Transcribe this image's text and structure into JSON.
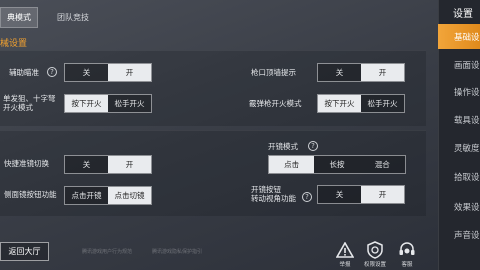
{
  "tabs": [
    {
      "label": "典模式",
      "active": true
    },
    {
      "label": "团队竞技",
      "active": false
    }
  ],
  "section_title": "械设置",
  "settings": {
    "aim_assist": {
      "label": "辅助瞄准",
      "options": [
        "关",
        "开"
      ],
      "selected": "开"
    },
    "scope_hint": {
      "label": "枪口顶墙提示",
      "options": [
        "关",
        "开"
      ],
      "selected": "开"
    },
    "single_fire": {
      "label_line1": "单发狙、十字弩",
      "label_line2": "开火模式",
      "options": [
        "按下开火",
        "松手开火"
      ],
      "selected": "按下开火"
    },
    "burst_fire": {
      "label": "霰弹枪开火模式",
      "options": [
        "按下开火",
        "松手开火"
      ],
      "selected": "按下开火"
    },
    "quick_scope": {
      "label": "快捷准镜切换",
      "options": [
        "关",
        "开"
      ],
      "selected": "开"
    },
    "scope_mode": {
      "label": "开镜模式",
      "options": [
        "点击",
        "长按",
        "混合"
      ],
      "selected": "点击"
    },
    "side_scope": {
      "label": "侧面镜按钮功能",
      "options": [
        "点击开镜",
        "点击切镜"
      ],
      "selected": "点击切镜"
    },
    "scope_view": {
      "label_line1": "开镜按钮",
      "label_line2": "转动视角功能",
      "options": [
        "关",
        "开"
      ],
      "selected": "开"
    }
  },
  "sidebar": {
    "title": "设置",
    "items": [
      {
        "label": "基础设",
        "active": true
      },
      {
        "label": "画面设",
        "active": false
      },
      {
        "label": "操作设",
        "active": false
      },
      {
        "label": "载具设",
        "active": false
      },
      {
        "label": "灵敏度",
        "active": false
      },
      {
        "label": "拾取设",
        "active": false
      },
      {
        "label": "效果设",
        "active": false
      },
      {
        "label": "声音设",
        "active": false
      }
    ]
  },
  "bottom": {
    "back_label": "返回大厅",
    "tip1": "腾讯游戏用户行为规范",
    "tip2": "腾讯游戏隐私保护指引",
    "icons": [
      {
        "label": "举报",
        "icon": "warning-icon"
      },
      {
        "label": "权限设置",
        "icon": "shield-gear-icon"
      },
      {
        "label": "客服",
        "icon": "headset-icon"
      }
    ]
  }
}
